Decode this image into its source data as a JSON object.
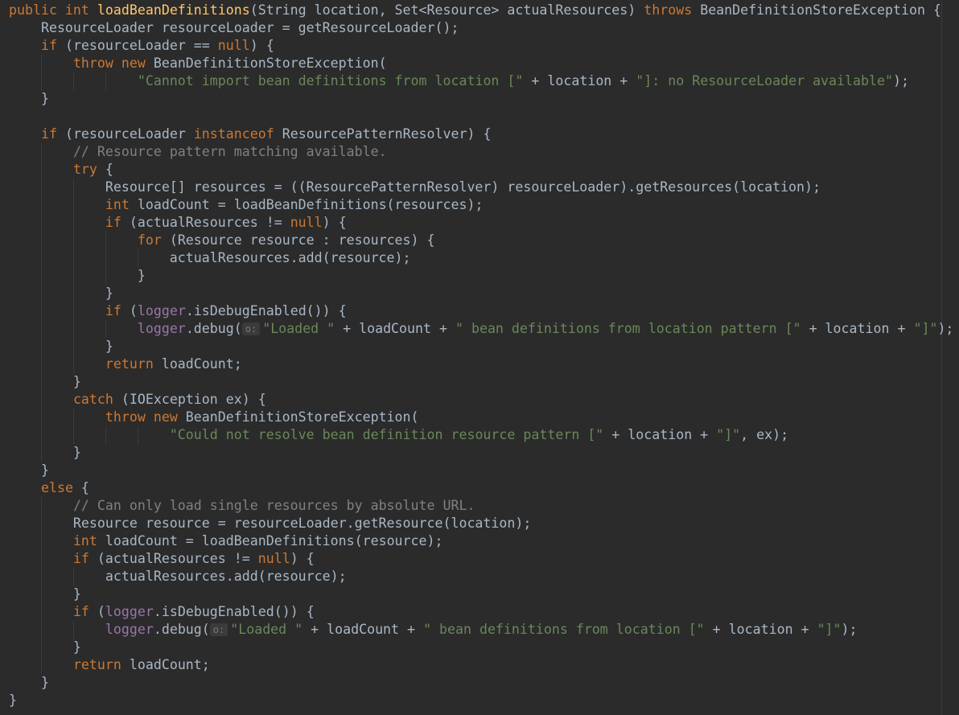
{
  "colors": {
    "background": "#2b2b2b",
    "default": "#a9b7c6",
    "keyword": "#cc7832",
    "function": "#ffc66d",
    "string": "#6a8759",
    "comment": "#808080",
    "field": "#9876aa"
  },
  "code": {
    "lines": [
      [
        {
          "t": "kw",
          "v": "public int "
        },
        {
          "t": "fn",
          "v": "loadBeanDefinitions"
        },
        {
          "t": "tok",
          "v": "(String location, Set<Resource> actualResources) "
        },
        {
          "t": "kw",
          "v": "throws "
        },
        {
          "t": "tok",
          "v": "BeanDefinitionStoreException {"
        }
      ],
      [
        {
          "t": "tok",
          "v": "    ResourceLoader resourceLoader = getResourceLoader();"
        }
      ],
      [
        {
          "t": "tok",
          "v": "    "
        },
        {
          "t": "kw",
          "v": "if "
        },
        {
          "t": "tok",
          "v": "(resourceLoader == "
        },
        {
          "t": "kw",
          "v": "null"
        },
        {
          "t": "tok",
          "v": ") {"
        }
      ],
      [
        {
          "t": "tok",
          "v": "        "
        },
        {
          "t": "kw",
          "v": "throw new "
        },
        {
          "t": "tok",
          "v": "BeanDefinitionStoreException("
        }
      ],
      [
        {
          "t": "tok",
          "v": "                "
        },
        {
          "t": "str",
          "v": "\"Cannot import bean definitions from location [\""
        },
        {
          "t": "tok",
          "v": " + location + "
        },
        {
          "t": "str",
          "v": "\"]: no ResourceLoader available\""
        },
        {
          "t": "tok",
          "v": ");"
        }
      ],
      [
        {
          "t": "tok",
          "v": "    }"
        }
      ],
      [
        {
          "t": "tok",
          "v": ""
        }
      ],
      [
        {
          "t": "tok",
          "v": "    "
        },
        {
          "t": "kw",
          "v": "if "
        },
        {
          "t": "tok",
          "v": "(resourceLoader "
        },
        {
          "t": "kw",
          "v": "instanceof "
        },
        {
          "t": "tok",
          "v": "ResourcePatternResolver) {"
        }
      ],
      [
        {
          "t": "tok",
          "v": "        "
        },
        {
          "t": "cm",
          "v": "// Resource pattern matching available."
        }
      ],
      [
        {
          "t": "tok",
          "v": "        "
        },
        {
          "t": "kw",
          "v": "try "
        },
        {
          "t": "tok",
          "v": "{"
        }
      ],
      [
        {
          "t": "tok",
          "v": "            Resource[] resources = ((ResourcePatternResolver) resourceLoader).getResources(location);"
        }
      ],
      [
        {
          "t": "tok",
          "v": "            "
        },
        {
          "t": "kw",
          "v": "int "
        },
        {
          "t": "tok",
          "v": "loadCount = loadBeanDefinitions(resources);"
        }
      ],
      [
        {
          "t": "tok",
          "v": "            "
        },
        {
          "t": "kw",
          "v": "if "
        },
        {
          "t": "tok",
          "v": "(actualResources != "
        },
        {
          "t": "kw",
          "v": "null"
        },
        {
          "t": "tok",
          "v": ") {"
        }
      ],
      [
        {
          "t": "tok",
          "v": "                "
        },
        {
          "t": "kw",
          "v": "for "
        },
        {
          "t": "tok",
          "v": "(Resource resource : resources) {"
        }
      ],
      [
        {
          "t": "tok",
          "v": "                    actualResources.add(resource);"
        }
      ],
      [
        {
          "t": "tok",
          "v": "                }"
        }
      ],
      [
        {
          "t": "tok",
          "v": "            }"
        }
      ],
      [
        {
          "t": "tok",
          "v": "            "
        },
        {
          "t": "kw",
          "v": "if "
        },
        {
          "t": "tok",
          "v": "("
        },
        {
          "t": "fld",
          "v": "logger"
        },
        {
          "t": "tok",
          "v": ".isDebugEnabled()) {"
        }
      ],
      [
        {
          "t": "tok",
          "v": "                "
        },
        {
          "t": "fld",
          "v": "logger"
        },
        {
          "t": "tok",
          "v": ".debug("
        },
        {
          "t": "hint",
          "v": "o:"
        },
        {
          "t": "str",
          "v": "\"Loaded \""
        },
        {
          "t": "tok",
          "v": " + loadCount + "
        },
        {
          "t": "str",
          "v": "\" bean definitions from location pattern [\""
        },
        {
          "t": "tok",
          "v": " + location + "
        },
        {
          "t": "str",
          "v": "\"]\""
        },
        {
          "t": "tok",
          "v": ");"
        }
      ],
      [
        {
          "t": "tok",
          "v": "            }"
        }
      ],
      [
        {
          "t": "tok",
          "v": "            "
        },
        {
          "t": "kw",
          "v": "return "
        },
        {
          "t": "tok",
          "v": "loadCount;"
        }
      ],
      [
        {
          "t": "tok",
          "v": "        }"
        }
      ],
      [
        {
          "t": "tok",
          "v": "        "
        },
        {
          "t": "kw",
          "v": "catch "
        },
        {
          "t": "tok",
          "v": "(IOException ex) {"
        }
      ],
      [
        {
          "t": "tok",
          "v": "            "
        },
        {
          "t": "kw",
          "v": "throw new "
        },
        {
          "t": "tok",
          "v": "BeanDefinitionStoreException("
        }
      ],
      [
        {
          "t": "tok",
          "v": "                    "
        },
        {
          "t": "str",
          "v": "\"Could not resolve bean definition resource pattern [\""
        },
        {
          "t": "tok",
          "v": " + location + "
        },
        {
          "t": "str",
          "v": "\"]\""
        },
        {
          "t": "tok",
          "v": ", ex);"
        }
      ],
      [
        {
          "t": "tok",
          "v": "        }"
        }
      ],
      [
        {
          "t": "tok",
          "v": "    }"
        }
      ],
      [
        {
          "t": "tok",
          "v": "    "
        },
        {
          "t": "kw",
          "v": "else "
        },
        {
          "t": "tok",
          "v": "{"
        }
      ],
      [
        {
          "t": "tok",
          "v": "        "
        },
        {
          "t": "cm",
          "v": "// Can only load single resources by absolute URL."
        }
      ],
      [
        {
          "t": "tok",
          "v": "        Resource resource = resourceLoader.getResource(location);"
        }
      ],
      [
        {
          "t": "tok",
          "v": "        "
        },
        {
          "t": "kw",
          "v": "int "
        },
        {
          "t": "tok",
          "v": "loadCount = loadBeanDefinitions(resource);"
        }
      ],
      [
        {
          "t": "tok",
          "v": "        "
        },
        {
          "t": "kw",
          "v": "if "
        },
        {
          "t": "tok",
          "v": "(actualResources != "
        },
        {
          "t": "kw",
          "v": "null"
        },
        {
          "t": "tok",
          "v": ") {"
        }
      ],
      [
        {
          "t": "tok",
          "v": "            actualResources.add(resource);"
        }
      ],
      [
        {
          "t": "tok",
          "v": "        }"
        }
      ],
      [
        {
          "t": "tok",
          "v": "        "
        },
        {
          "t": "kw",
          "v": "if "
        },
        {
          "t": "tok",
          "v": "("
        },
        {
          "t": "fld",
          "v": "logger"
        },
        {
          "t": "tok",
          "v": ".isDebugEnabled()) {"
        }
      ],
      [
        {
          "t": "tok",
          "v": "            "
        },
        {
          "t": "fld",
          "v": "logger"
        },
        {
          "t": "tok",
          "v": ".debug("
        },
        {
          "t": "hint",
          "v": "o:"
        },
        {
          "t": "str",
          "v": "\"Loaded \""
        },
        {
          "t": "tok",
          "v": " + loadCount + "
        },
        {
          "t": "str",
          "v": "\" bean definitions from location [\""
        },
        {
          "t": "tok",
          "v": " + location + "
        },
        {
          "t": "str",
          "v": "\"]\""
        },
        {
          "t": "tok",
          "v": ");"
        }
      ],
      [
        {
          "t": "tok",
          "v": "        }"
        }
      ],
      [
        {
          "t": "tok",
          "v": "        "
        },
        {
          "t": "kw",
          "v": "return "
        },
        {
          "t": "tok",
          "v": "loadCount;"
        }
      ],
      [
        {
          "t": "tok",
          "v": "    }"
        }
      ],
      [
        {
          "t": "tok",
          "v": "}"
        }
      ]
    ]
  }
}
